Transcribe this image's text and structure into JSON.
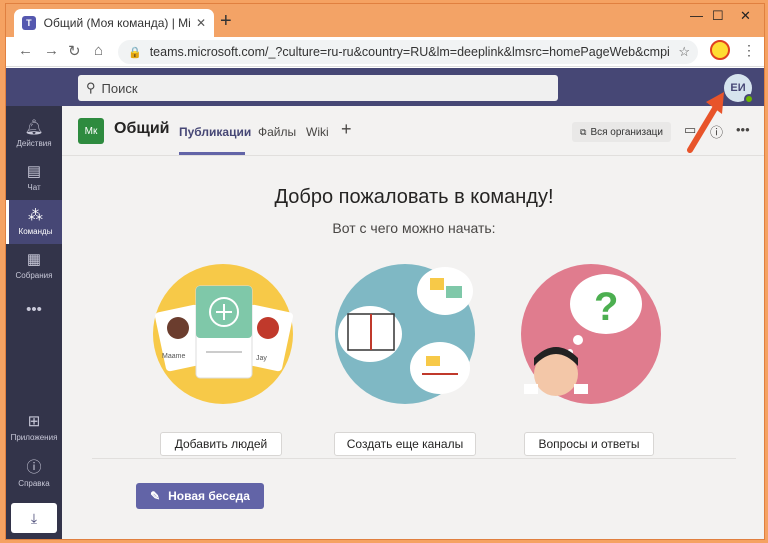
{
  "browser": {
    "tab_title": "Общий (Моя команда) | Microso",
    "tab_close": "✕",
    "new_tab": "+",
    "url": "teams.microsoft.com/_?culture=ru-ru&country=RU&lm=deeplink&lmsrc=homePageWeb&cmpid=We..."
  },
  "teams_header": {
    "search_placeholder": "Поиск",
    "avatar_initials": "ЕИ"
  },
  "rail": {
    "items": [
      {
        "label": "Действия",
        "icon": "bell-icon"
      },
      {
        "label": "Чат",
        "icon": "chat-icon"
      },
      {
        "label": "Команды",
        "icon": "teams-icon"
      },
      {
        "label": "Собрания",
        "icon": "calendar-icon"
      },
      {
        "label": "",
        "icon": "more-icon"
      },
      {
        "label": "Приложения",
        "icon": "apps-icon"
      },
      {
        "label": "Справка",
        "icon": "help-icon"
      }
    ]
  },
  "channel": {
    "team_avatar": "Мк",
    "team_name": "Общий",
    "tabs": [
      {
        "label": "Публикации"
      },
      {
        "label": "Файлы"
      },
      {
        "label": "Wiki"
      }
    ],
    "org_button": "Вся организаци"
  },
  "welcome": {
    "title": "Добро пожаловать в команду!",
    "subtitle": "Вот с чего можно начать:",
    "card1_button": "Добавить людей",
    "card2_button": "Создать еще каналы",
    "card3_button": "Вопросы и ответы",
    "card1_names": [
      "Maame",
      "Jay"
    ]
  },
  "compose": {
    "new_conversation": "Новая беседа"
  },
  "colors": {
    "teams_purple": "#464775",
    "accent": "#6264a7",
    "rail": "#33344a",
    "arrow": "#e8542a"
  }
}
